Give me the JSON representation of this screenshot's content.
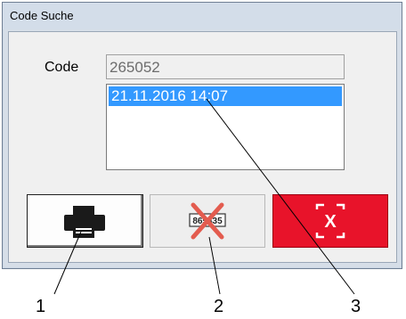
{
  "window": {
    "title": "Code Suche"
  },
  "form": {
    "code_label": "Code",
    "code_value": "265052",
    "list_items": [
      "21.11.2016 14:07"
    ]
  },
  "buttons": {
    "print_icon": "printer-icon",
    "cancel_icon": "crossed-out-code-icon",
    "cancel_code_text": "865435",
    "close_icon": "close-x-icon",
    "close_text": "X"
  },
  "callouts": [
    "1",
    "2",
    "3"
  ],
  "colors": {
    "selection": "#3399ff",
    "close_button": "#e8132a",
    "cancel_cross": "#e35c4f"
  }
}
